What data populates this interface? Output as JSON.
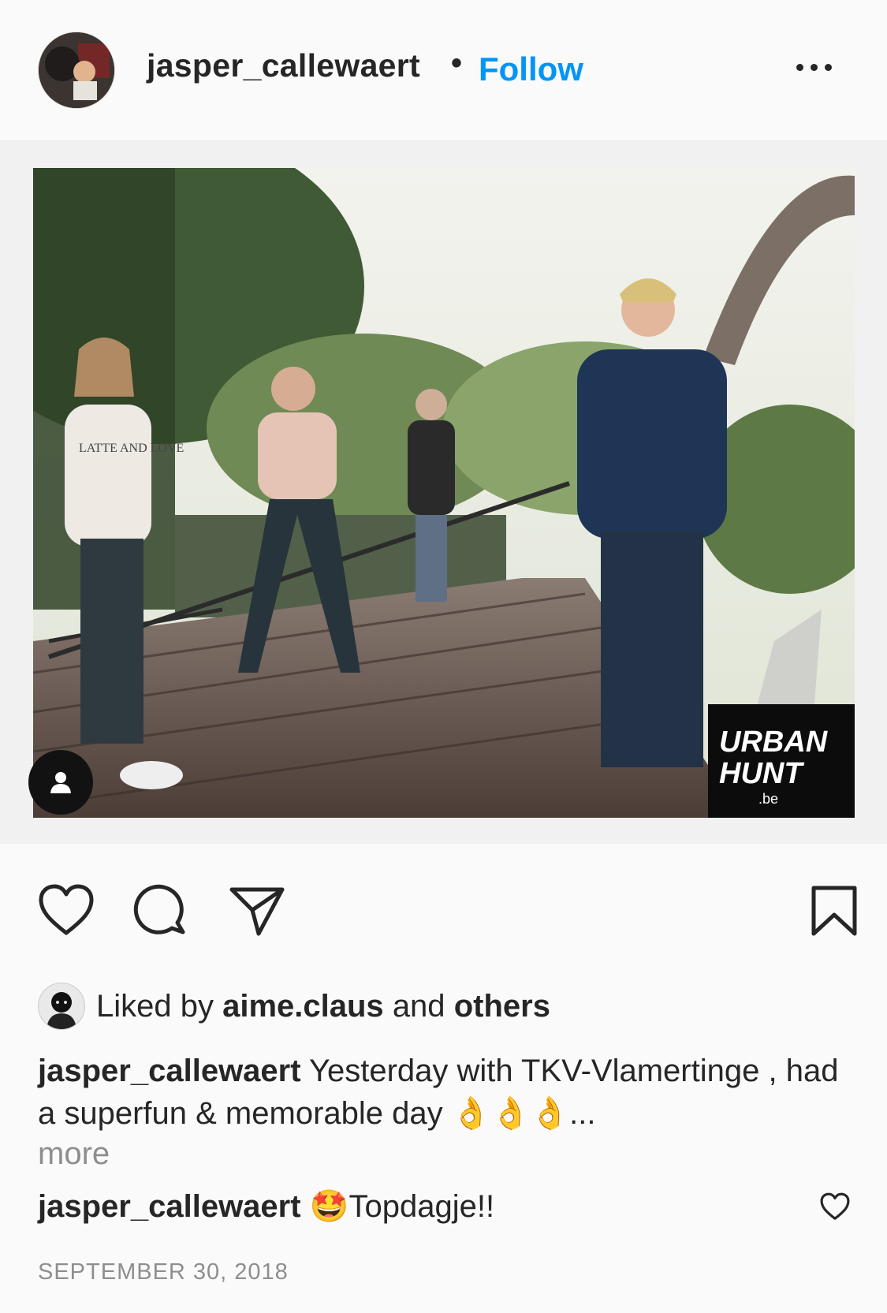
{
  "header": {
    "username": "jasper_callewaert",
    "separator": "•",
    "follow_label": "Follow"
  },
  "media": {
    "watermark_line1": "URBAN",
    "watermark_line2": "HUNT",
    "watermark_line3": ".be",
    "shirt_text": "LATTE AND LOVE"
  },
  "likes": {
    "prefix": "Liked by",
    "user": "aime.claus",
    "and": "and",
    "others": "others"
  },
  "caption": {
    "username": "jasper_callewaert",
    "text": "Yesterday with TKV-Vlamertinge , had a superfun & memorable day 👌👌👌...",
    "more_label": "more"
  },
  "comment": {
    "username": "jasper_callewaert",
    "text": "🤩Topdagje!!"
  },
  "date": "SEPTEMBER 30, 2018",
  "icons": [
    "more-options-icon",
    "user-tag-icon",
    "heart-icon",
    "comment-icon",
    "share-icon",
    "bookmark-icon",
    "comment-heart-icon"
  ],
  "colors": {
    "follow": "#0095f6",
    "text": "#262626",
    "muted": "#8e8e8e",
    "background": "#fafafa"
  }
}
